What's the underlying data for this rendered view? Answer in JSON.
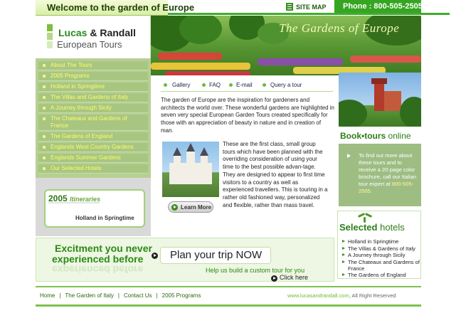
{
  "topbar": {
    "welcome": "Welcome to the garden of Europe",
    "sitemap": "SITE MAP",
    "phone": "Phone : 800-505-2505"
  },
  "logo": {
    "name_part1": "Lucas",
    "name_amp": " & ",
    "name_part2": "Randall",
    "subtitle": "European Tours"
  },
  "header": {
    "title": "The Gardens of Europe"
  },
  "leftnav": {
    "items": [
      "About The Tours",
      "2005 Programs",
      "Holland in Springtime",
      "The Villas and Gardens of Italy",
      "A Journey through Sicily",
      "The Chateaux and Gardens of France",
      "The Gardens of England",
      "Englands West Country Gardens",
      "Englands Summer Gardens",
      "Our Selected Hotels"
    ]
  },
  "itineraries": {
    "year": "2005",
    "label": "Itineraries",
    "destination": "Holland in Springtime"
  },
  "subnav": {
    "links": [
      "Gallery",
      "FAQ",
      "E-mail",
      "Query a tour"
    ]
  },
  "main": {
    "intro": "The garden of Europe are the inspiration for gardeners and architects the world over. These wonderful gardens are highlighted in seven very special European Garden Tours created specifically for those with an appreciation of beauty in nature and in creation of man.",
    "body": "These are the first class, small group tours which have been planned with the overriding consideration of using your time to the best possible advan-tage. They are designed to appear to first time visitors to a country as well as experienced travellers. This is touring in a rather old fashioned way, personalized and flexible, rather than mass travel.",
    "learn_more": "Learn More"
  },
  "booktours": {
    "heading_bold": "Book",
    "heading_dot": "•",
    "heading_tours": "tours",
    "heading_online": " online",
    "text": "To find out more about these tours and to receive a 20-page color brochure, call our Italian tour expert at ",
    "phone": "800-505-2505."
  },
  "hotels": {
    "heading_bold": "Selected",
    "heading_rest": " hotels",
    "items": [
      "Holland in Springtime",
      "The Villas & Gardens of Italy",
      "A Journey through Sicily",
      "The Chateaux and Gardens of France",
      "The Gardens of England"
    ]
  },
  "banner": {
    "line1": "Excitment you never",
    "line2": "experienced before",
    "plan": "Plan your trip NOW",
    "help": "Help us build a custom tour for you",
    "click": "Click here"
  },
  "footer": {
    "links": [
      "Home",
      "The Garden of Italy",
      "Contact Us",
      "2005 Programs"
    ],
    "url": "www.lucasandrandall.com",
    "rights": ", All Right Reserved"
  },
  "colors": {
    "brand_green": "#36a521",
    "nav_bg": "#b7cf93",
    "nav_text": "#fdfd6a",
    "heading_green": "#2e7d17"
  }
}
